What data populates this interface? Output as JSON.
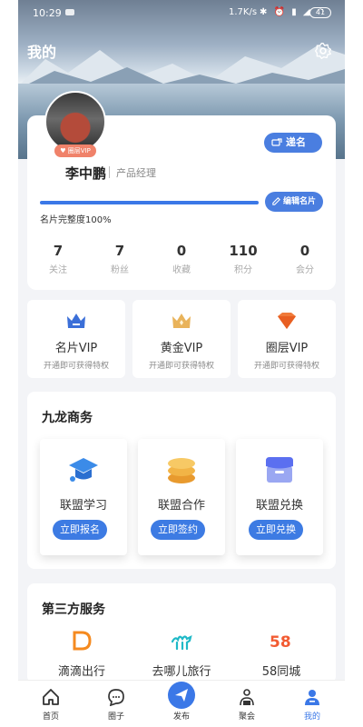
{
  "status_bar": {
    "time": "10:29",
    "network": "1.7K/s",
    "battery": "41"
  },
  "header": {
    "title": "我的",
    "settings_icon": "gear-icon"
  },
  "profile": {
    "name": "李中鹏",
    "job": "产品经理",
    "vip_badge": "圈层VIP",
    "send_card_label": "递名片",
    "edit_card_label": "编辑名片",
    "completeness_label": "名片完整度100%",
    "completeness": 1.0,
    "stats": [
      {
        "value": "7",
        "label": "关注"
      },
      {
        "value": "7",
        "label": "粉丝"
      },
      {
        "value": "0",
        "label": "收藏"
      },
      {
        "value": "110",
        "label": "积分"
      },
      {
        "value": "0",
        "label": "会分"
      }
    ]
  },
  "vips": [
    {
      "title": "名片VIP",
      "subtitle": "开通即可获得特权",
      "icon": "crown-icon",
      "color": "#3b6fd8"
    },
    {
      "title": "黄金VIP",
      "subtitle": "开通即可获得特权",
      "icon": "gold-crown-icon",
      "color": "#e9b35a"
    },
    {
      "title": "圈层VIP",
      "subtitle": "开通即可获得特权",
      "icon": "diamond-icon",
      "color": "#f07a3a"
    }
  ],
  "business": {
    "title": "九龙商务",
    "items": [
      {
        "title": "联盟学习",
        "button": "立即报名",
        "icon": "graduation-cap-icon"
      },
      {
        "title": "联盟合作",
        "button": "立即签约",
        "icon": "coin-stack-icon"
      },
      {
        "title": "联盟兑换",
        "button": "立即兑换",
        "icon": "shop-icon"
      }
    ]
  },
  "third_party": {
    "title": "第三方服务",
    "items": [
      {
        "title": "滴滴出行",
        "icon": "didi-icon"
      },
      {
        "title": "去哪儿旅行",
        "icon": "camel-icon"
      },
      {
        "title": "58同城",
        "icon": "58-icon",
        "logo_text": "58"
      }
    ]
  },
  "tabbar": {
    "items": [
      {
        "label": "首页",
        "icon": "home-icon"
      },
      {
        "label": "圈子",
        "icon": "chat-bubble-icon"
      },
      {
        "label": "发布",
        "icon": "paper-plane-icon"
      },
      {
        "label": "聚会",
        "icon": "people-icon"
      },
      {
        "label": "我的",
        "icon": "user-icon"
      }
    ],
    "active": "我的"
  }
}
